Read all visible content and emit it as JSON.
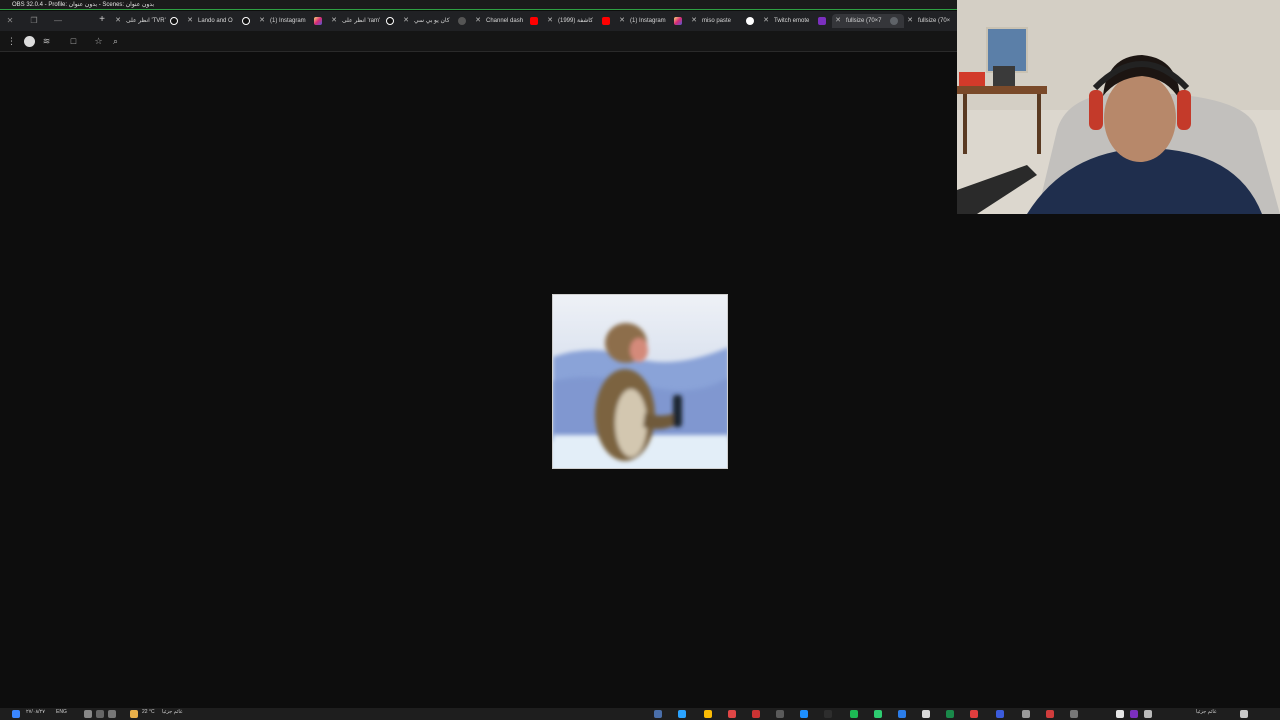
{
  "obs": {
    "title": "OBS 32.0.4 - Profile: بدون عنوان - Scenes: بدون عنوان"
  },
  "tabs": [
    {
      "label": "انظر على 'TVR'",
      "favicon": "tiktok",
      "active": false
    },
    {
      "label": "Lando and O",
      "favicon": "tiktok",
      "active": false
    },
    {
      "label": "(1) Instagram",
      "favicon": "instagram",
      "active": false
    },
    {
      "label": "انظر على 'ram'",
      "favicon": "tiktok",
      "active": false
    },
    {
      "label": "كان يو بي سي",
      "favicon": "bbc",
      "active": false
    },
    {
      "label": "Channel dash",
      "favicon": "youtube",
      "active": false
    },
    {
      "label": "كاشفة (1999)",
      "favicon": "youtube",
      "active": false
    },
    {
      "label": "(1) Instagram",
      "favicon": "instagram",
      "active": false
    },
    {
      "label": "miso paste",
      "favicon": "google",
      "active": false
    },
    {
      "label": "Twitch emote",
      "favicon": "twitch",
      "active": false
    },
    {
      "label": "fullsize (70×7",
      "favicon": "gray",
      "active": true
    },
    {
      "label": "fullsize (70×",
      "favicon": "gray",
      "active": false
    }
  ],
  "toolbar": {
    "icons": [
      "profile-icon",
      "extensions-icon",
      "reading-list-icon",
      "bookmark-star-icon",
      "zoom-icon"
    ]
  },
  "viewport": {
    "content": "image",
    "image_name": "monkey-image"
  },
  "taskbar": {
    "date": "٢٧/٠٨/٢٧",
    "weather": "22 °C",
    "weather_label": "غائم جزئيا",
    "language": "ENG",
    "right_label": "غائم جزئيا"
  }
}
